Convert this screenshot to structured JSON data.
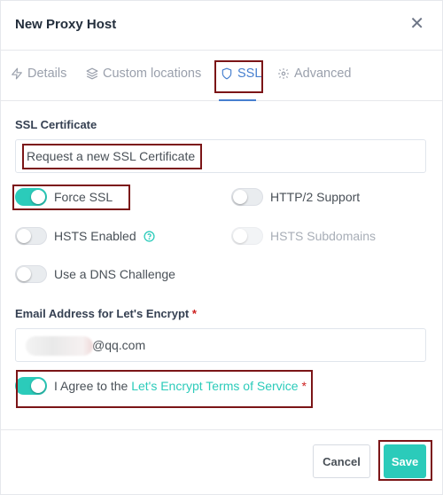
{
  "modal": {
    "title": "New Proxy Host",
    "close_icon": "close-icon"
  },
  "tabs": [
    {
      "label": "Details",
      "icon": "bolt-icon",
      "active": false
    },
    {
      "label": "Custom locations",
      "icon": "layers-icon",
      "active": false
    },
    {
      "label": "SSL",
      "icon": "shield-icon",
      "active": true
    },
    {
      "label": "Advanced",
      "icon": "gear-icon",
      "active": false
    }
  ],
  "ssl": {
    "certificate_label": "SSL Certificate",
    "certificate_value": "Request a new SSL Certificate",
    "toggles": {
      "force_ssl": {
        "label": "Force SSL",
        "on": true
      },
      "http2": {
        "label": "HTTP/2 Support",
        "on": false
      },
      "hsts_enabled": {
        "label": "HSTS Enabled",
        "on": false
      },
      "hsts_subdomains": {
        "label": "HSTS Subdomains",
        "on": false,
        "disabled": true
      },
      "dns_challenge": {
        "label": "Use a DNS Challenge",
        "on": false
      }
    },
    "email_label": "Email Address for Let's Encrypt",
    "required_mark": "*",
    "email_value": "@qq.com",
    "agree_prefix": "I Agree to the",
    "agree_link": "Let's Encrypt Terms of Service",
    "agree_on": true
  },
  "footer": {
    "cancel_label": "Cancel",
    "save_label": "Save"
  },
  "colors": {
    "accent": "#2bcbba",
    "active_tab": "#467fcf",
    "annotation": "#7b1517",
    "required": "#cd201f"
  }
}
